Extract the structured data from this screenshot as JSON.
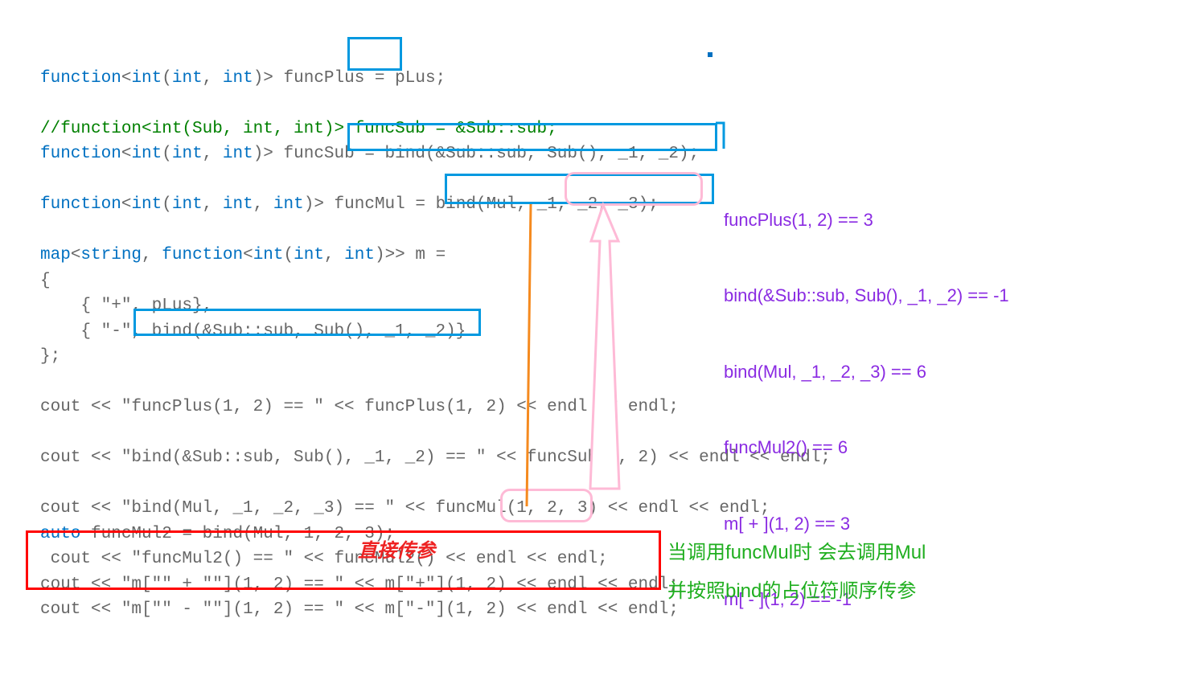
{
  "code": {
    "l1_func": "function",
    "l1_int": "int",
    "l1_paren": "(",
    "l1_int2": "int",
    "l1_comma": ", ",
    "l1_int3": "int",
    "l1_close": ")> funcPlus = ",
    "l1_plus": "pLus",
    "l1_semi": ";",
    "l2_comment": "//function<int(Sub, int, int)> funcSub = &Sub::sub;",
    "l3_a": "function",
    "l3_b": "int",
    "l3_c": "int",
    "l3_d": "int",
    "l3_mid": ")> funcSub = ",
    "l3_bind": "bind(&Sub::sub, Sub(), _1, _2)",
    "l3_semi": ";",
    "l4_a": "function",
    "l4_b": "int",
    "l4_c": "int",
    "l4_d": "int",
    "l4_e": "int",
    "l4_mid": ")> funcMul = ",
    "l4_bind1": "bind(Mul, ",
    "l4_args": "_1, _2, _3",
    "l4_close": ");",
    "l5_a": "map",
    "l5_b": "string",
    "l5_c": "function",
    "l5_d": "int",
    "l5_e": "int",
    "l5_f": "int",
    "l5_close": ")>> m =",
    "l6_open": "{",
    "l7": "    { \"+\", pLus},",
    "l8_a": "    { \"-\", ",
    "l8_bind": "bind(&Sub::sub, Sub(), _1, _2)",
    "l8_close": "}",
    "l9": "};",
    "l10": "cout << \"funcPlus(1, 2) == \" << funcPlus(1, 2) << endl << endl;",
    "l11": "cout << \"bind(&Sub::sub, Sub(), _1, _2) == \" << funcSub(1, 2) << endl << endl;",
    "l12_a": "cout << \"bind(Mul, _1, _2, _3) == \" << funcMul",
    "l12_args": "(1, 2, 3)",
    "l12_b": " << endl << endl;",
    "l13_a": "auto",
    "l13_b": " funcMul2 = bind(Mul, 1, 2, 3);",
    "l14": " cout << \"funcMul2() == \" << funcMul2() << endl << endl;",
    "l15": "cout << \"m[\"\" + \"\"](1, 2) == \" << m[\"+\"](1, 2) << endl << endl;",
    "l16": "cout << \"m[\"\" - \"\"](1, 2) == \" << m[\"-\"](1, 2) << endl << endl;"
  },
  "output": {
    "o1": "funcPlus(1, 2) == 3",
    "o2": "bind(&Sub::sub, Sub(), _1, _2) == -1",
    "o3": "bind(Mul, _1, _2, _3) == 6",
    "o4": "funcMul2() == 6",
    "o5": "m[ + ](1, 2) == 3",
    "o6": "m[ - ](1, 2) == -1"
  },
  "annotations": {
    "red": "直接传参",
    "green1": "当调用funcMul时 会去调用Mul",
    "green2": "并按照bind的占位符顺序传参"
  }
}
